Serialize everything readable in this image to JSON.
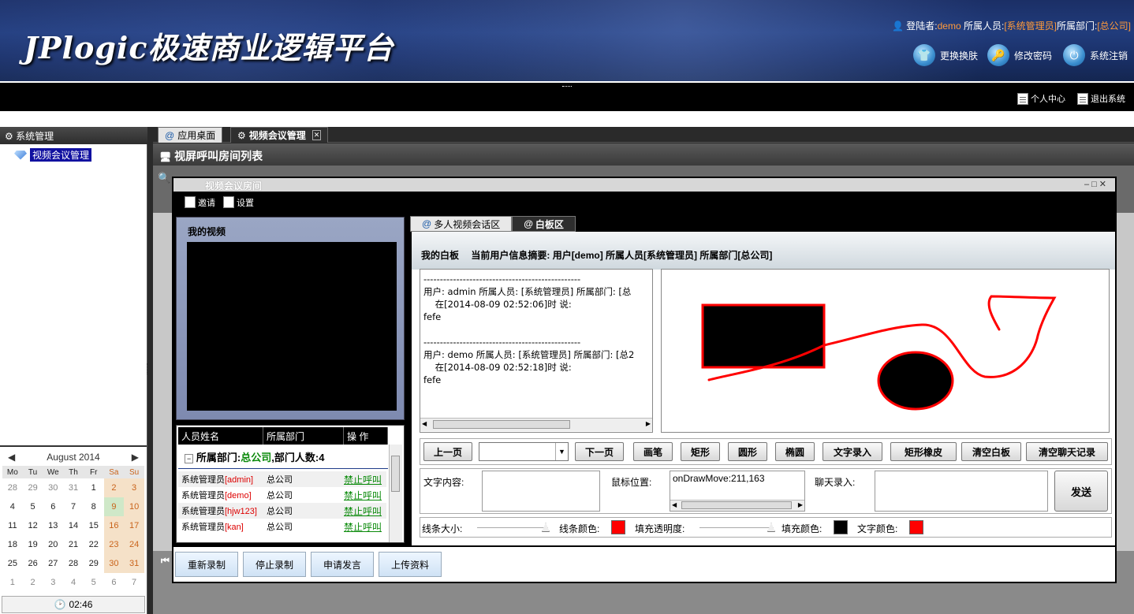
{
  "header": {
    "logo_text": "JPlogic极速商业逻辑平台",
    "login_label": "登陆者:",
    "login_user": "demo",
    "role_label": "所属人员:",
    "role_value": "[系统管理员]",
    "dept_label": "所属部门:",
    "dept_value": "[总公司]",
    "buttons": [
      "更换换肤",
      "修改密码",
      "系统注销"
    ]
  },
  "topbar": {
    "links": [
      "个人中心",
      "退出系统"
    ]
  },
  "sidebar": {
    "title": "系统管理",
    "items": [
      {
        "label": "视频会议管理",
        "selected": true
      }
    ]
  },
  "calendar": {
    "month_label": "August 2014",
    "dow": [
      "Mo",
      "Tu",
      "We",
      "Th",
      "Fr",
      "Sa",
      "Su"
    ],
    "weeks": [
      [
        "28",
        "29",
        "30",
        "31",
        "1",
        "2",
        "3"
      ],
      [
        "4",
        "5",
        "6",
        "7",
        "8",
        "9",
        "10"
      ],
      [
        "11",
        "12",
        "13",
        "14",
        "15",
        "16",
        "17"
      ],
      [
        "18",
        "19",
        "20",
        "21",
        "22",
        "23",
        "24"
      ],
      [
        "25",
        "26",
        "27",
        "28",
        "29",
        "30",
        "31"
      ],
      [
        "1",
        "2",
        "3",
        "4",
        "5",
        "6",
        "7"
      ]
    ],
    "today": "9",
    "time": "02:46"
  },
  "main_tabs": [
    {
      "label": "应用桌面",
      "active": false
    },
    {
      "label": "视频会议管理",
      "active": true
    }
  ],
  "content_title": "视屏呼叫房间列表",
  "dialog": {
    "title": "视频会议房间",
    "toolbar": [
      "邀请",
      "设置"
    ],
    "my_video_label": "我的视频",
    "people_headers": [
      "人员姓名",
      "所属部门",
      "操 作"
    ],
    "dept_line_prefix": "所属部门:",
    "dept_name": "总公司",
    "dept_count_text": ",部门人数:4",
    "people": [
      {
        "role": "系统管理员",
        "name": "[admin]",
        "dept": "总公司",
        "action": "禁止呼叫"
      },
      {
        "role": "系统管理员",
        "name": "[demo]",
        "dept": "总公司",
        "action": "禁止呼叫"
      },
      {
        "role": "系统管理员",
        "name": "[hjw123]",
        "dept": "总公司",
        "action": "禁止呼叫"
      },
      {
        "role": "系统管理员",
        "name": "[kan]",
        "dept": "总公司",
        "action": "禁止呼叫"
      }
    ],
    "right_tabs": [
      {
        "label": "多人视频会话区",
        "active": false
      },
      {
        "label": "白板区",
        "active": true
      }
    ],
    "whiteboard_title": "我的白板",
    "summary_text": "当前用户信息摘要: 用户[demo] 所属人员[系统管理员] 所属部门[总公司]",
    "chat_log": "------------------------------------------------\n用户: admin 所属人员: [系统管理员] 所属部门: [总\n    在[2014-08-09 02:52:06]时 说:\nfefe\n\n------------------------------------------------\n用户: demo 所属人员: [系统管理员] 所属部门: [总2\n    在[2014-08-09 02:52:18]时 说:\nfefe",
    "tool_buttons": [
      "上一页",
      "下一页",
      "画笔",
      "矩形",
      "圆形",
      "椭圆",
      "文字录入",
      "矩形橡皮",
      "清空白板",
      "清空聊天记录"
    ],
    "text_content_label": "文字内容:",
    "mouse_pos_label": "鼠标位置:",
    "mouse_pos_value": "onDrawMove:211,163",
    "chat_input_label": "聊天录入:",
    "send_label": "发送",
    "line_size_label": "线条大小:",
    "line_color_label": "线条颜色:",
    "fill_opacity_label": "填充透明度:",
    "fill_color_label": "填充颜色:",
    "text_color_label": "文字颜色:",
    "colors": {
      "line": "#ff0000",
      "fill": "#000000",
      "text": "#ff0000"
    },
    "footer_buttons": [
      "重新录制",
      "停止录制",
      "申请发言",
      "上传资料"
    ]
  }
}
